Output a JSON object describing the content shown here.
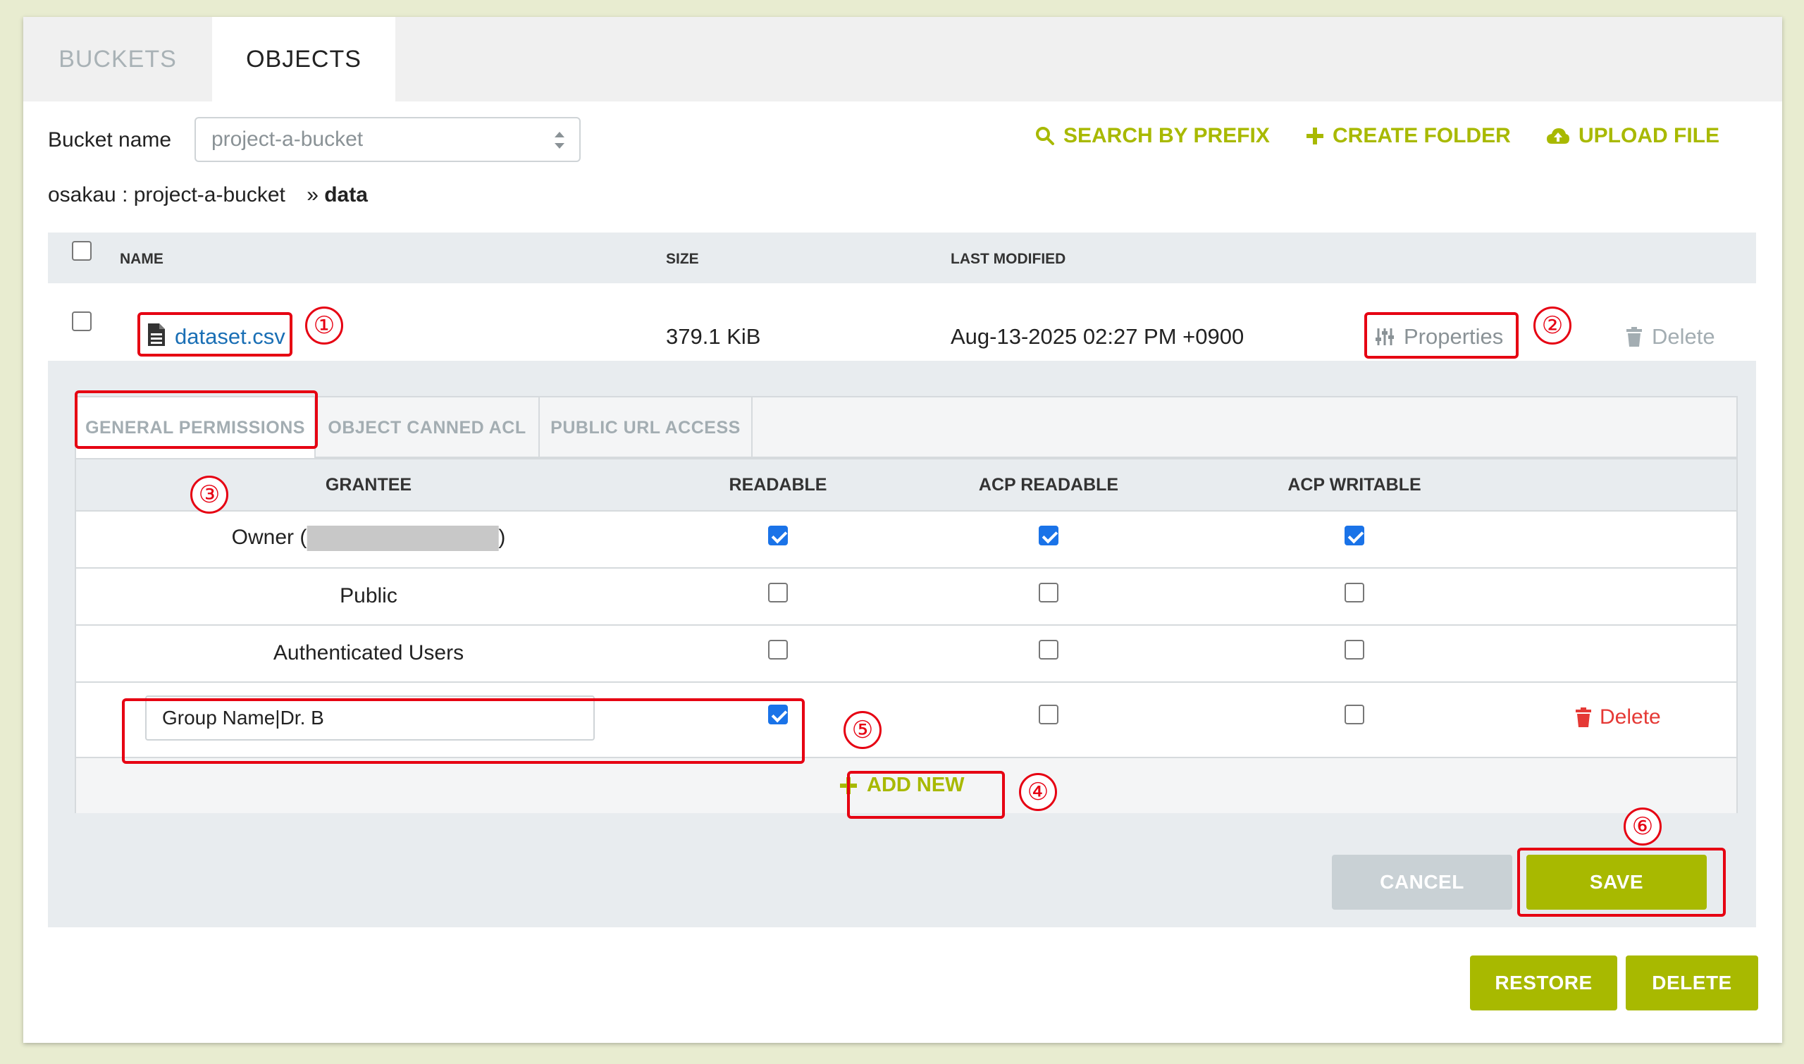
{
  "tabs": {
    "buckets": "BUCKETS",
    "objects": "OBJECTS"
  },
  "bucket": {
    "label": "Bucket name",
    "selected": "project-a-bucket"
  },
  "actions": {
    "search": "SEARCH BY PREFIX",
    "create_folder": "CREATE FOLDER",
    "upload": "UPLOAD FILE"
  },
  "breadcrumb": {
    "path": "osakau : project-a-bucket",
    "sep": "»",
    "current": "data"
  },
  "file_table": {
    "headers": {
      "name": "NAME",
      "size": "SIZE",
      "modified": "LAST MODIFIED"
    },
    "row": {
      "name": "dataset.csv",
      "size": "379.1 KiB",
      "modified": "Aug-13-2025 02:27 PM +0900",
      "properties": "Properties",
      "delete": "Delete"
    }
  },
  "perm_tabs": {
    "general": "GENERAL PERMISSIONS",
    "canned": "OBJECT CANNED ACL",
    "public_url": "PUBLIC URL ACCESS"
  },
  "perm_table": {
    "headers": {
      "grantee": "GRANTEE",
      "readable": "READABLE",
      "acp_readable": "ACP READABLE",
      "acp_writable": "ACP WRITABLE"
    },
    "rows": [
      {
        "grantee_prefix": "Owner (",
        "grantee_suffix": ")",
        "readable": true,
        "acp_readable": true,
        "acp_writable": true
      },
      {
        "grantee": "Public",
        "readable": false,
        "acp_readable": false,
        "acp_writable": false
      },
      {
        "grantee": "Authenticated Users",
        "readable": false,
        "acp_readable": false,
        "acp_writable": false
      },
      {
        "grantee_input": "Group Name|Dr. B",
        "readable": true,
        "acp_readable": false,
        "acp_writable": false,
        "delete": "Delete"
      }
    ],
    "add_new": "ADD NEW"
  },
  "buttons": {
    "cancel": "CANCEL",
    "save": "SAVE",
    "restore": "RESTORE",
    "delete": "DELETE"
  },
  "markers": [
    "①",
    "②",
    "③",
    "④",
    "⑤",
    "⑥"
  ],
  "colors": {
    "accent": "#a8b900",
    "annotation": "#e60012",
    "link": "#1a6fb5",
    "danger": "#e53935"
  }
}
